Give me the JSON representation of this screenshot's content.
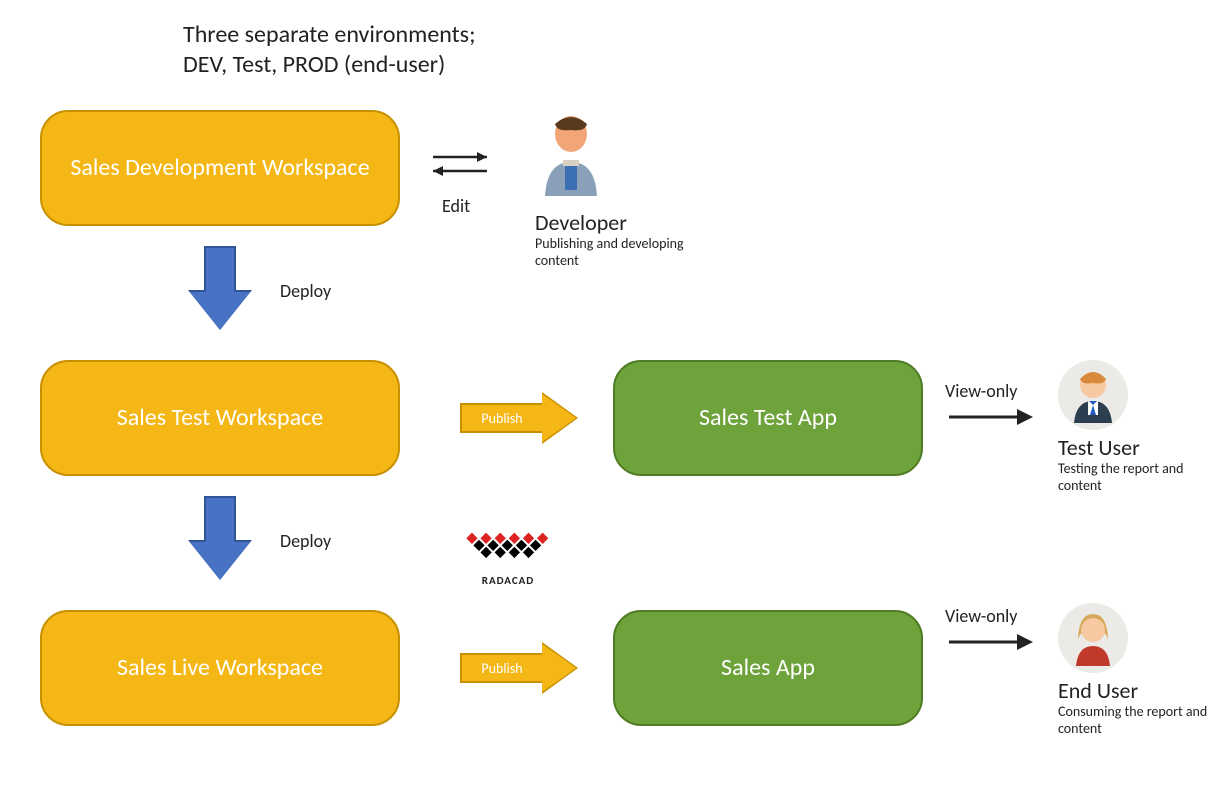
{
  "heading": {
    "line1": "Three separate environments;",
    "line2": "DEV, Test, PROD (end-user)"
  },
  "boxes": {
    "dev_workspace": "Sales Development Workspace",
    "test_workspace": "Sales Test Workspace",
    "live_workspace": "Sales Live Workspace",
    "test_app": "Sales Test App",
    "sales_app": "Sales App"
  },
  "arrows": {
    "deploy1": "Deploy",
    "deploy2": "Deploy",
    "publish1": "Publish",
    "publish2": "Publish",
    "edit": "Edit",
    "viewonly1": "View-only",
    "viewonly2": "View-only"
  },
  "users": {
    "developer": {
      "title": "Developer",
      "sub": "Publishing and developing content"
    },
    "testuser": {
      "title": "Test User",
      "sub": "Testing the report and content"
    },
    "enduser": {
      "title": "End User",
      "sub": "Consuming the report and content"
    }
  },
  "logo": {
    "label": "RADACAD"
  }
}
